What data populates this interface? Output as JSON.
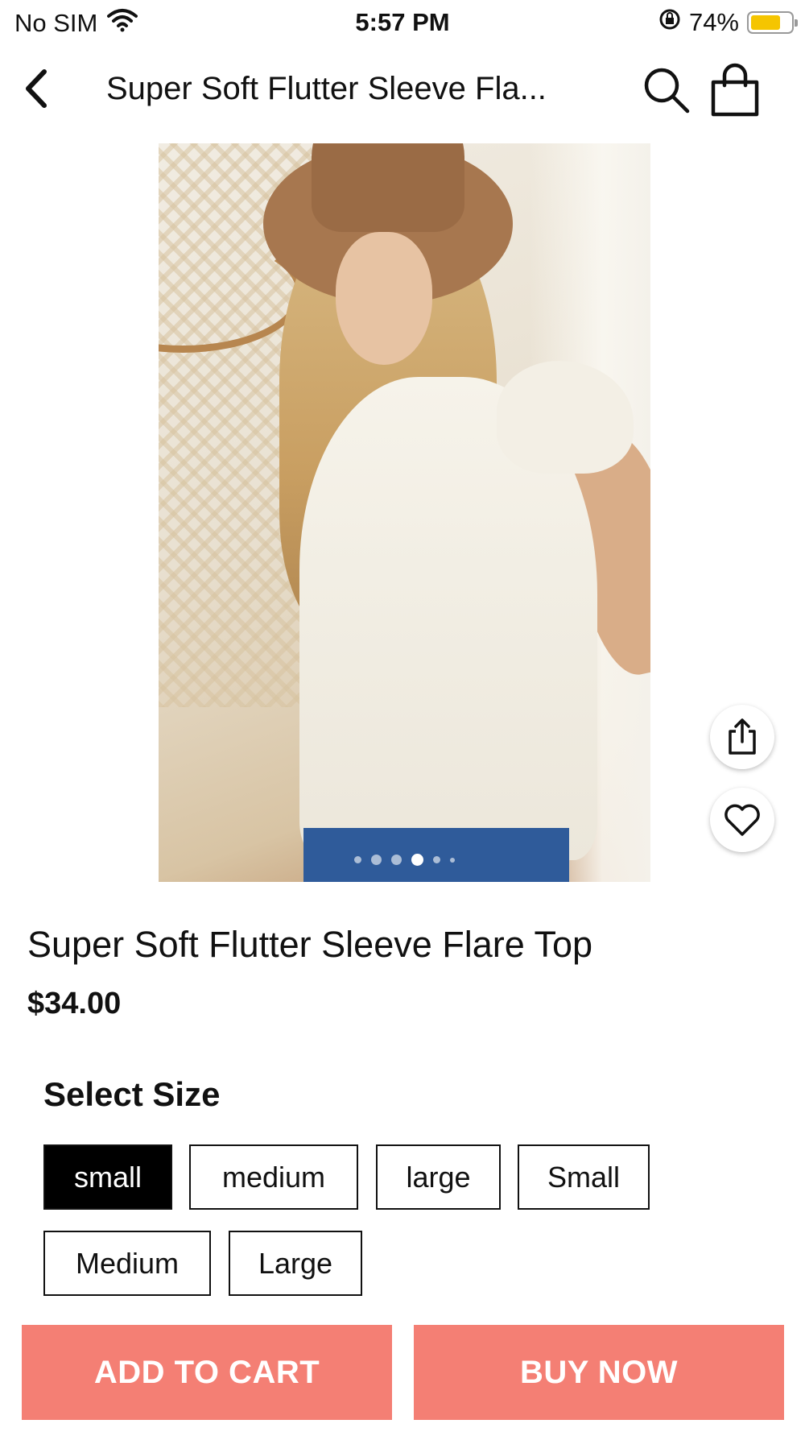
{
  "status_bar": {
    "carrier": "No SIM",
    "time": "5:57 PM",
    "battery_percent": "74%",
    "battery_level": 0.74,
    "battery_color": "#f5c500"
  },
  "nav": {
    "title": "Super Soft Flutter Sleeve Fla...",
    "back_icon": "chevron-left-icon",
    "search_icon": "search-icon",
    "bag_icon": "shopping-bag-icon"
  },
  "gallery": {
    "image_count": 6,
    "active_index": 3
  },
  "product": {
    "title": "Super Soft Flutter Sleeve Flare Top",
    "price": "$34.00"
  },
  "sizes": {
    "heading": "Select Size",
    "options": [
      "small",
      "medium",
      "large",
      "Small",
      "Medium",
      "Large"
    ],
    "selected": "small"
  },
  "actions": {
    "add_to_cart": "ADD TO CART",
    "buy_now": "BUY NOW",
    "accent_color": "#f47f74"
  }
}
